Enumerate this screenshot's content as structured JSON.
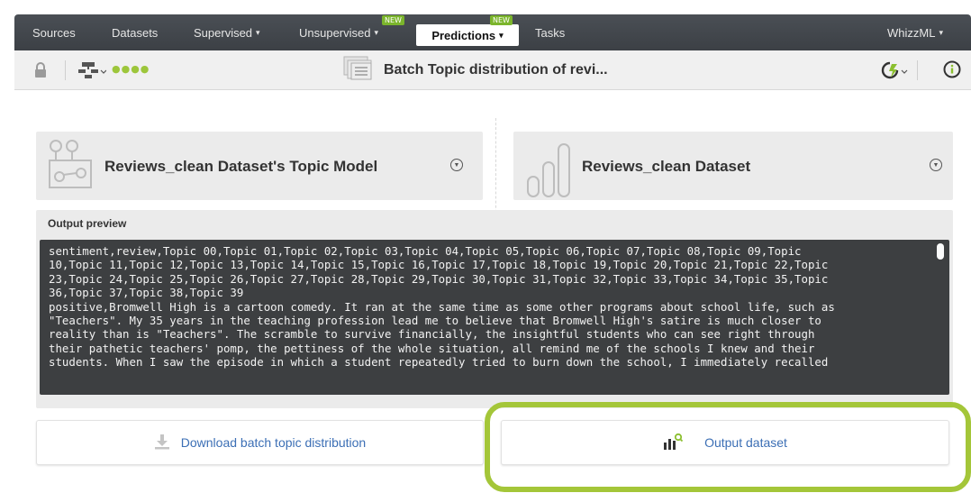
{
  "navbar": {
    "items": [
      {
        "label": "Sources"
      },
      {
        "label": "Datasets"
      },
      {
        "label": "Supervised",
        "caret": "▾"
      },
      {
        "label": "Unsupervised",
        "caret": "▾",
        "badge": "NEW"
      },
      {
        "label": "Predictions",
        "caret": "▾",
        "badge": "NEW",
        "active": true
      },
      {
        "label": "Tasks"
      }
    ],
    "right": {
      "label": "WhizzML",
      "caret": "▾"
    }
  },
  "toolbar": {
    "title": "Batch Topic distribution of revi...",
    "dots": "●●●●"
  },
  "cards": {
    "left": {
      "title": "Reviews_clean Dataset's Topic Model"
    },
    "right": {
      "title": "Reviews_clean Dataset"
    }
  },
  "preview": {
    "label": "Output preview",
    "text": "sentiment,review,Topic 00,Topic 01,Topic 02,Topic 03,Topic 04,Topic 05,Topic 06,Topic 07,Topic 08,Topic 09,Topic\n10,Topic 11,Topic 12,Topic 13,Topic 14,Topic 15,Topic 16,Topic 17,Topic 18,Topic 19,Topic 20,Topic 21,Topic 22,Topic\n23,Topic 24,Topic 25,Topic 26,Topic 27,Topic 28,Topic 29,Topic 30,Topic 31,Topic 32,Topic 33,Topic 34,Topic 35,Topic\n36,Topic 37,Topic 38,Topic 39\npositive,Bromwell High is a cartoon comedy. It ran at the same time as some other programs about school life, such as\n\"Teachers\". My 35 years in the teaching profession lead me to believe that Bromwell High's satire is much closer to\nreality than is \"Teachers\". The scramble to survive financially, the insightful students who can see right through\ntheir pathetic teachers' pomp, the pettiness of the whole situation, all remind me of the schools I knew and their\nstudents. When I saw the episode in which a student repeatedly tried to burn down the school, I immediately recalled"
  },
  "buttons": {
    "download": "Download batch topic distribution",
    "output": "Output dataset"
  },
  "colors": {
    "navbar": "#43474c",
    "accent_link": "#3c6fb5",
    "highlight": "#a4c639",
    "badge": "#7bb52c",
    "dots": "#9dc63b"
  }
}
